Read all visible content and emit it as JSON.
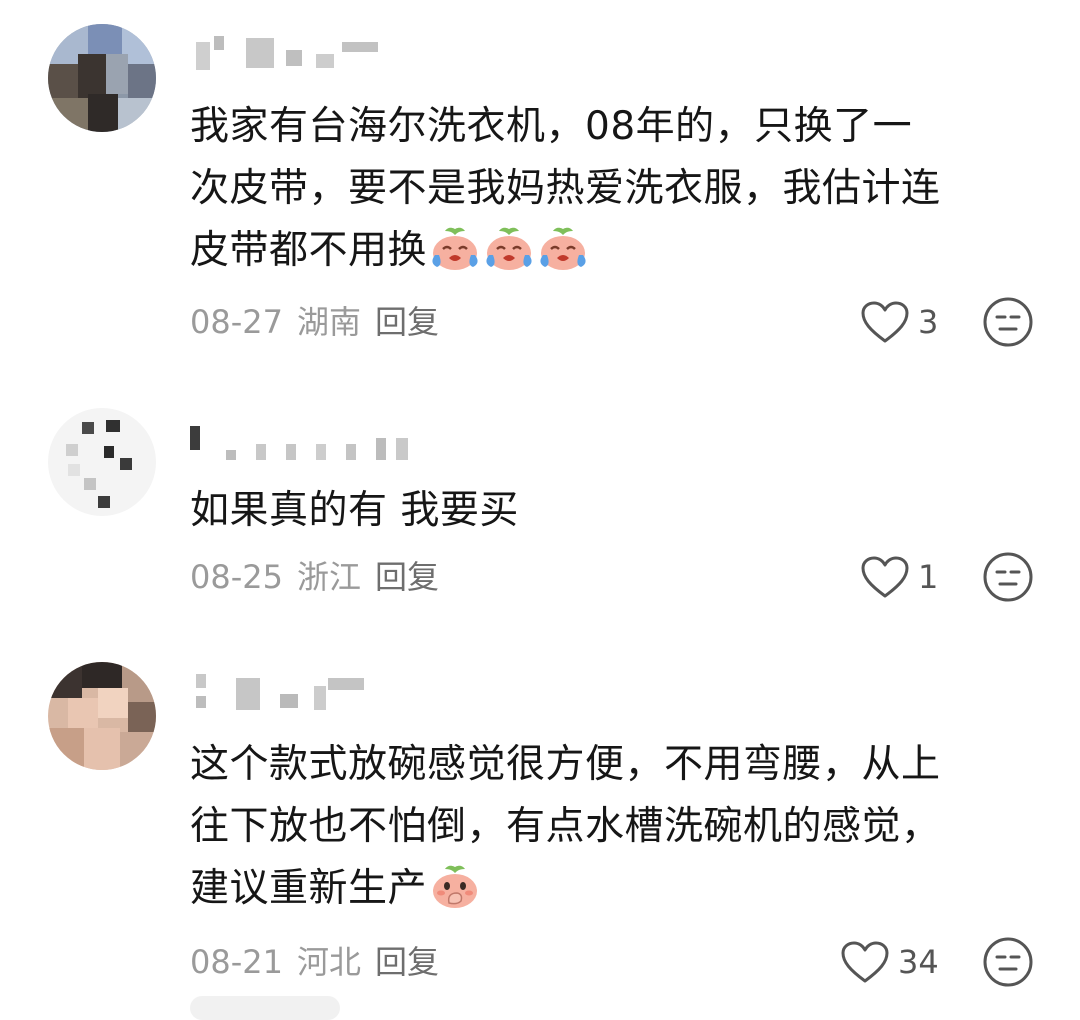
{
  "comments": [
    {
      "text_lines": [
        "我家有台海尔洗衣机，08年的，只换了一",
        "次皮带，要不是我妈热爱洗衣服，我估计连",
        "皮带都不用换"
      ],
      "emoji": "crying-face-emoji",
      "emoji_count": 3,
      "date": "08-27",
      "location": "湖南",
      "reply_label": "回复",
      "likes": "3"
    },
    {
      "text_lines": [
        "如果真的有 我要买"
      ],
      "date": "08-25",
      "location": "浙江",
      "reply_label": "回复",
      "likes": "1"
    },
    {
      "text_lines": [
        "这个款式放碗感觉很方便，不用弯腰，从上",
        "往下放也不怕倒，有点水槽洗碗机的感觉，",
        "建议重新生产"
      ],
      "emoji": "hand-over-mouth-emoji",
      "emoji_count": 1,
      "date": "08-21",
      "location": "河北",
      "reply_label": "回复",
      "likes": "34"
    }
  ],
  "icons": {
    "like": "heart-outline-icon",
    "react": "neutral-face-icon"
  },
  "colors": {
    "text": "#161616",
    "meta": "#9a9a9a",
    "icon": "#555555"
  }
}
